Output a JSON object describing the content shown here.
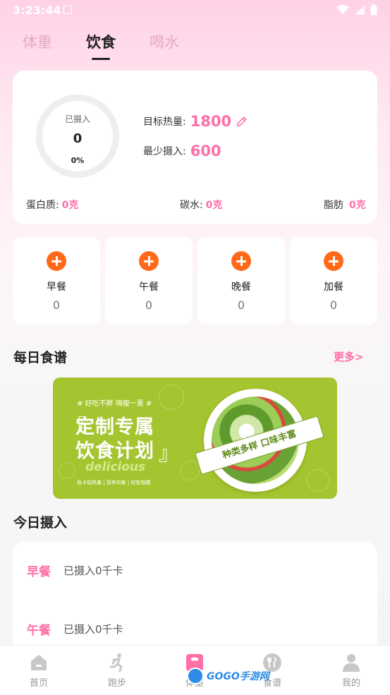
{
  "status_bar": {
    "time": "3:23:44"
  },
  "tabs": [
    {
      "label": "体重"
    },
    {
      "label": "饮食"
    },
    {
      "label": "喝水"
    }
  ],
  "summary": {
    "ring_label": "已摄入",
    "ring_value": "0",
    "ring_percent": "0%",
    "goal_label": "目标热量:",
    "goal_value": "1800",
    "min_label": "最少摄入:",
    "min_value": "600",
    "protein_label": "蛋白质:",
    "protein_value": "0克",
    "carbs_label": "碳水:",
    "carbs_value": "0克",
    "fat_label": "脂肪",
    "fat_value": "0克"
  },
  "meals": [
    {
      "name": "早餐",
      "count": "0"
    },
    {
      "name": "午餐",
      "count": "0"
    },
    {
      "name": "晚餐",
      "count": "0"
    },
    {
      "name": "加餐",
      "count": "0"
    }
  ],
  "recipes": {
    "title": "每日食谱",
    "more": "更多>",
    "banner": {
      "tag": "# 好吃不胖  嗨瘦一夏 #",
      "line1": "定制专属",
      "line2": "饮食计划",
      "script": "delicious",
      "sub": "低卡低热量 | 营养均衡 | 轻松饱腹",
      "ribbon": "种类多样 口味丰富"
    }
  },
  "intake": {
    "title": "今日摄入",
    "rows": [
      {
        "meal": "早餐",
        "text": "已摄入0千卡"
      },
      {
        "meal": "午餐",
        "text": "已摄入0千卡"
      }
    ]
  },
  "nav": [
    {
      "label": "首页",
      "icon": "home-icon"
    },
    {
      "label": "跑步",
      "icon": "running-icon"
    },
    {
      "label": "体重",
      "icon": "scale-icon"
    },
    {
      "label": "食谱",
      "icon": "fork-spoon-icon"
    },
    {
      "label": "我的",
      "icon": "user-icon"
    }
  ],
  "watermark": "GOGO手游网",
  "colors": {
    "accent": "#ff6fa8",
    "orange": "#ff6a1a",
    "banner_green": "#a4c52f"
  }
}
